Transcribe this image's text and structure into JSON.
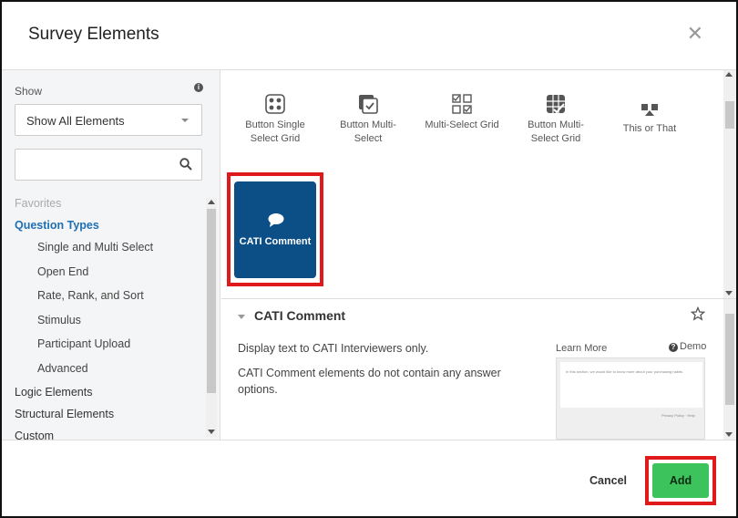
{
  "dialog": {
    "title": "Survey Elements",
    "close_icon": "close-icon"
  },
  "sidebar": {
    "show_label": "Show",
    "info_icon": "info-icon",
    "show_select_value": "Show All Elements",
    "search_placeholder": "",
    "favorites": "Favorites",
    "question_types": "Question Types",
    "sub_items": [
      {
        "label": "Single and Multi Select"
      },
      {
        "label": "Open End"
      },
      {
        "label": "Rate, Rank, and Sort"
      },
      {
        "label": "Stimulus"
      },
      {
        "label": "Participant Upload"
      },
      {
        "label": "Advanced"
      }
    ],
    "logic_elements": "Logic Elements",
    "structural_elements": "Structural Elements",
    "custom": "Custom"
  },
  "gallery": {
    "items": [
      {
        "label": "Button Single Select Grid",
        "icon": "button-single-select-grid-icon"
      },
      {
        "label": "Button Multi-Select",
        "icon": "button-multi-select-icon"
      },
      {
        "label": "Multi-Select Grid",
        "icon": "multi-select-grid-icon"
      },
      {
        "label": "Button Multi-Select Grid",
        "icon": "button-multi-select-grid-icon"
      },
      {
        "label": "This or That",
        "icon": "this-or-that-icon"
      }
    ],
    "selected": {
      "label": "CATI Comment",
      "icon": "speech-bubble-icon",
      "color": "#0c4f87"
    }
  },
  "detail": {
    "title": "CATI Comment",
    "description": "Display text to CATI Interviewers only.",
    "note": "CATI Comment elements do not contain any answer options.",
    "learn_more": "Learn More",
    "demo": "Demo",
    "preview_text": "In this section, we would like to know more about your purchasing habits.",
    "preview_footer": "Privacy Policy · Help"
  },
  "footer": {
    "cancel": "Cancel",
    "add": "Add",
    "add_color": "#3dc35c",
    "highlight_color": "#e0191a"
  }
}
